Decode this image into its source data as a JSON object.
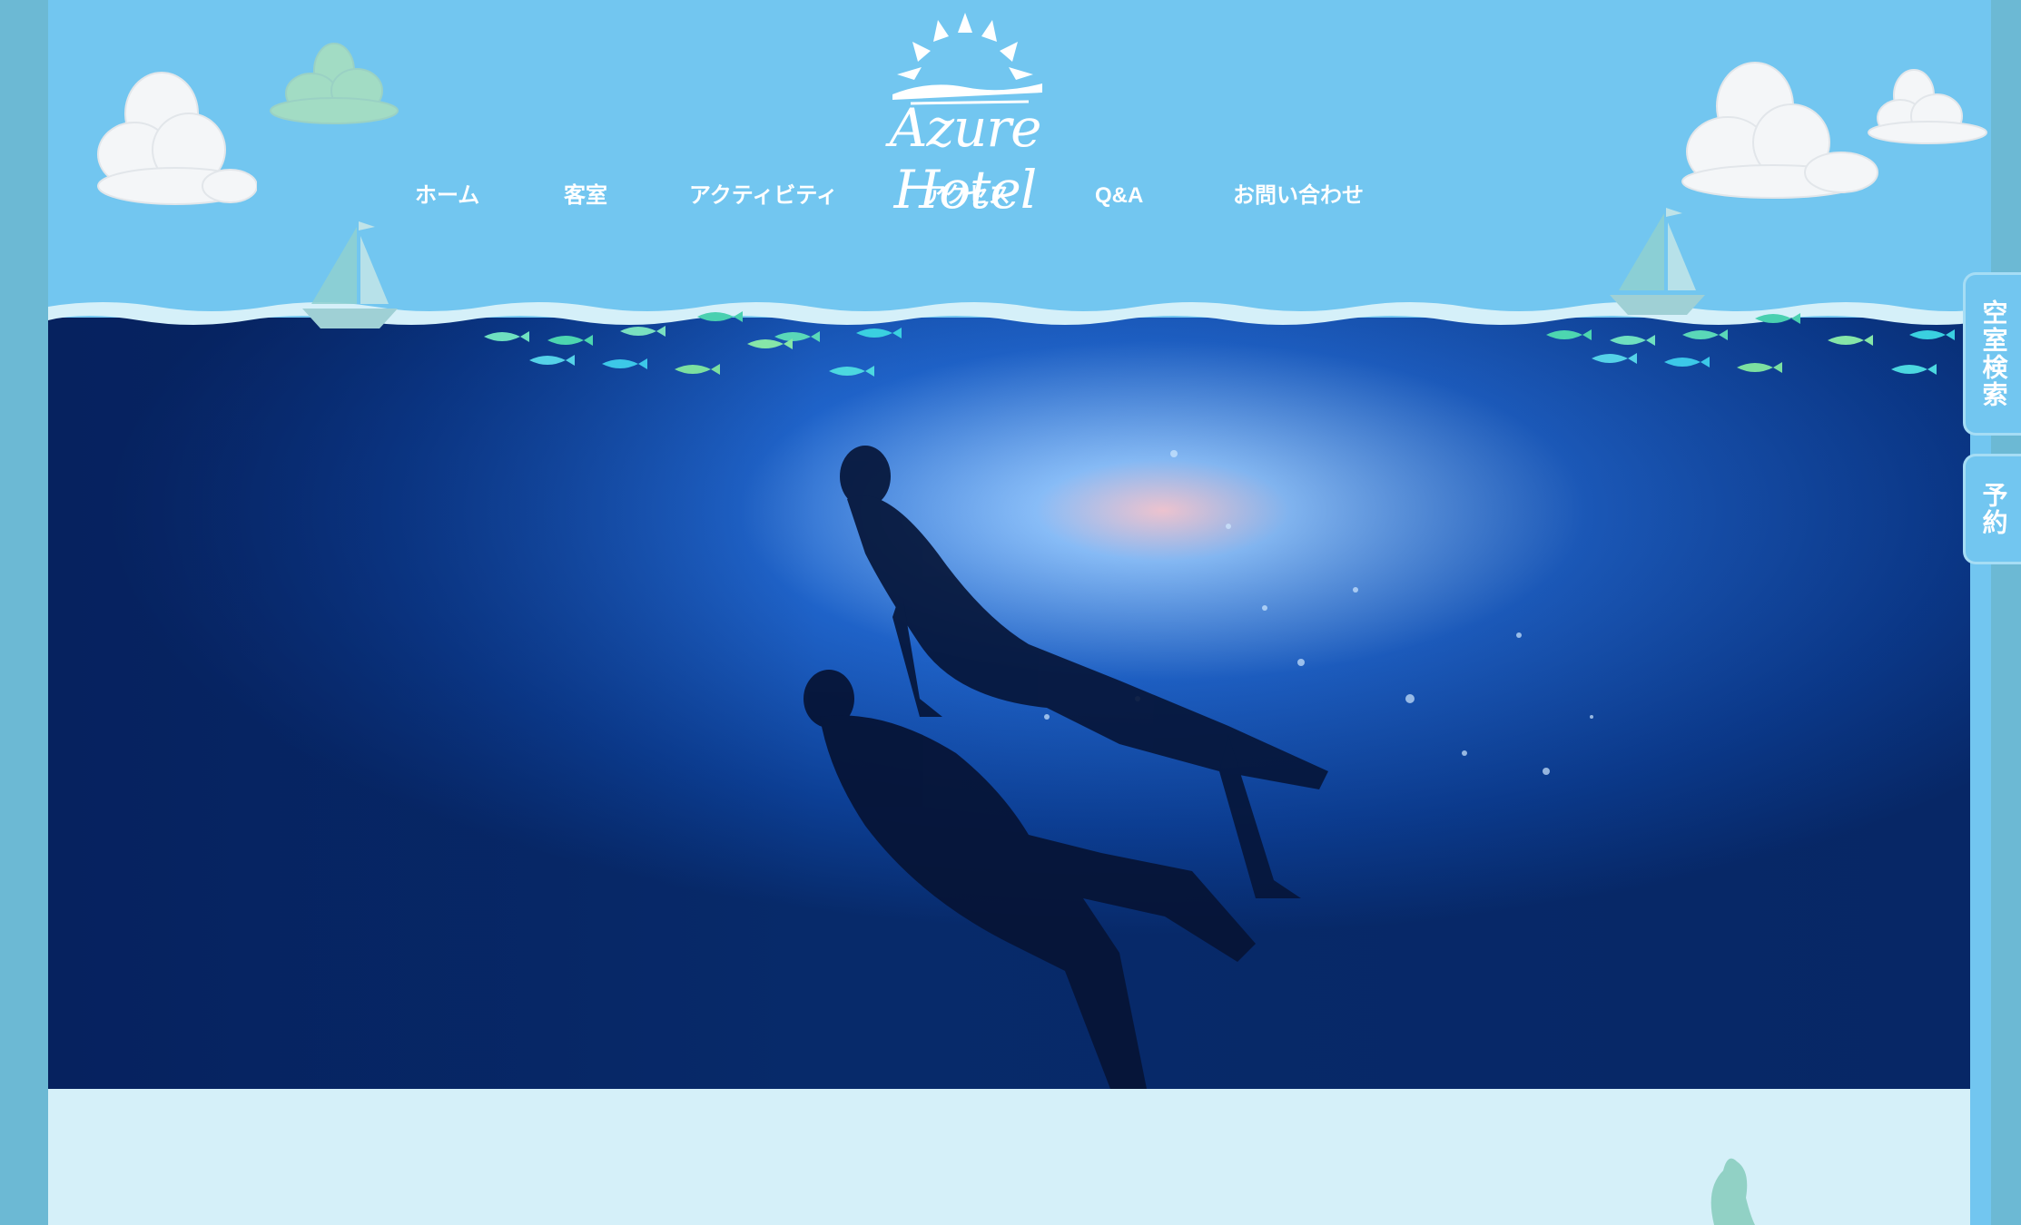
{
  "brand": {
    "logo_text": "Azure Hotel"
  },
  "nav": [
    {
      "label": "ホーム"
    },
    {
      "label": "客室"
    },
    {
      "label": "アクティビティ"
    },
    {
      "label": "アクセス"
    },
    {
      "label": "Q&A"
    },
    {
      "label": "お問い合わせ"
    }
  ],
  "side_tabs": [
    {
      "label": "空室検索"
    },
    {
      "label": "予約"
    }
  ],
  "colors": {
    "sky": "#72c6f0",
    "sea_deep": "#0a3a8c",
    "sea_light": "#1e6fd0",
    "foam": "#d5f0f9",
    "frame": "#6cb9d4"
  }
}
